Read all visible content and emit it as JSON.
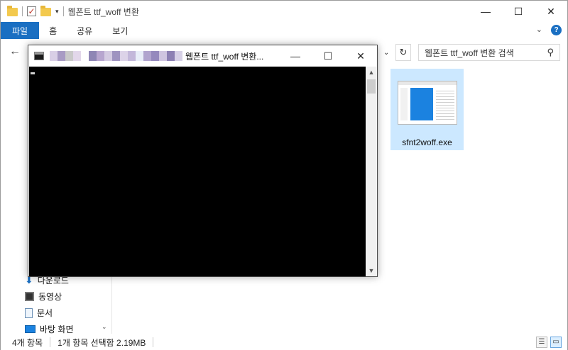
{
  "explorer": {
    "title": "웹폰트 ttf_woff 변환",
    "ribbon_tabs": [
      "파일",
      "홈",
      "공유",
      "보기"
    ],
    "search_placeholder": "웹폰트 ttf_woff 변환 검색",
    "sidebar_items": [
      {
        "label": "다운로드",
        "icon": "download-icon"
      },
      {
        "label": "동영상",
        "icon": "video-icon"
      },
      {
        "label": "문서",
        "icon": "document-icon"
      },
      {
        "label": "바탕 화면",
        "icon": "desktop-icon"
      }
    ],
    "files": [
      {
        "name": "sfnt2woff.exe",
        "icon": "exe-file-icon",
        "selected": true
      }
    ],
    "status": {
      "count": "4개 항목",
      "selection": "1개 항목 선택함 2.19MB"
    },
    "colors": {
      "accent": "#1a6fc2",
      "selection": "#cce8ff"
    }
  },
  "console": {
    "title": "웹폰트 ttf_woff 변환..."
  }
}
